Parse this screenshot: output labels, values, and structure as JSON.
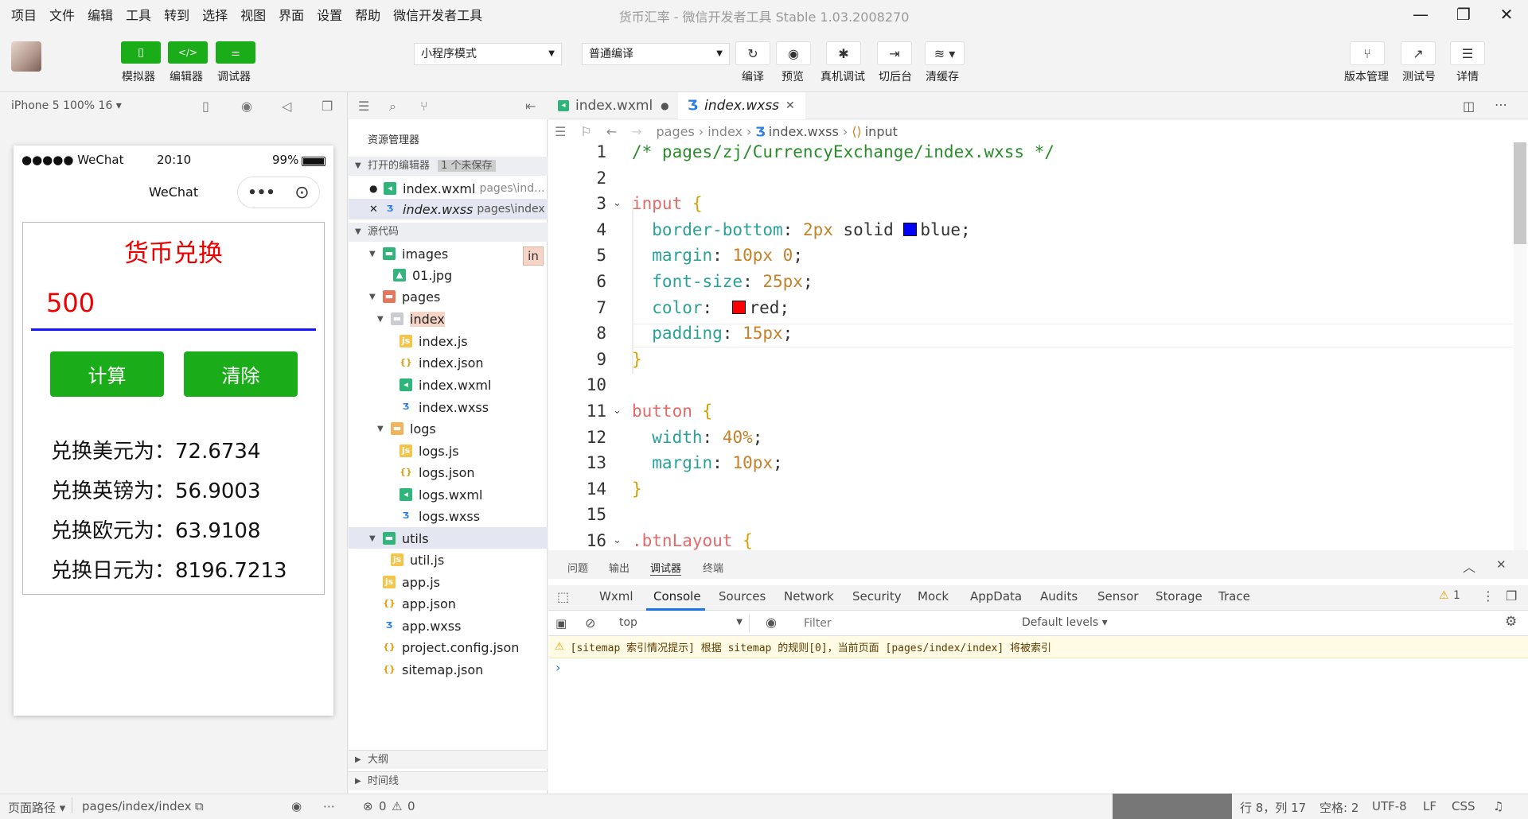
{
  "menu": [
    "项目",
    "文件",
    "编辑",
    "工具",
    "转到",
    "选择",
    "视图",
    "界面",
    "设置",
    "帮助",
    "微信开发者工具"
  ],
  "window_title": "货币汇率 - 微信开发者工具 Stable 1.03.2008270",
  "toolbar": {
    "simulator": "模拟器",
    "editor": "编辑器",
    "debugger": "调试器",
    "mode": "小程序模式",
    "compile_mode": "普通编译",
    "compile": "编译",
    "preview": "预览",
    "real_debug": "真机调试",
    "background": "切后台",
    "clear_cache": "清缓存",
    "version": "版本管理",
    "test": "测试号",
    "details": "详情"
  },
  "sim": {
    "device": "iPhone 5 100% 16 ▾",
    "carrier": "●●●●● WeChat",
    "time": "20:10",
    "battery": "99%",
    "nav_title": "WeChat",
    "app_title": "货币兑换",
    "amount": "500",
    "calc_btn": "计算",
    "clear_btn": "清除",
    "results": [
      "兑换美元为：72.6734",
      "兑换英镑为：56.9003",
      "兑换欧元为：63.9108",
      "兑换日元为：8196.7213"
    ]
  },
  "explorer": {
    "title": "资源管理器",
    "open_editors": "打开的编辑器",
    "unsaved": "1 个未保存",
    "open_files": [
      {
        "name": "index.wxml",
        "path": "pages\\ind..."
      },
      {
        "name": "index.wxss",
        "path": "pages\\index"
      }
    ],
    "source": "源代码",
    "tree": [
      "images",
      "01.jpg",
      "pages",
      "index",
      "index.js",
      "index.json",
      "index.wxml",
      "index.wxss",
      "logs",
      "logs.js",
      "logs.json",
      "logs.wxml",
      "logs.wxss",
      "utils",
      "util.js",
      "app.js",
      "app.json",
      "app.wxss",
      "project.config.json",
      "sitemap.json"
    ],
    "badge": "in",
    "outline": "大纲",
    "timeline": "时间线"
  },
  "editor": {
    "tabs": [
      "index.wxml",
      "index.wxss"
    ],
    "breadcrumb": [
      "pages",
      "index",
      "index.wxss",
      "input"
    ],
    "line_numbers": [
      "1",
      "2",
      "3",
      "4",
      "5",
      "6",
      "7",
      "8",
      "9",
      "10",
      "11",
      "12",
      "13",
      "14",
      "15",
      "16"
    ],
    "lines": [
      [
        {
          "t": "/* pages/zj/CurrencyExchange/index.wxss */",
          "c": "cm"
        }
      ],
      [],
      [
        {
          "t": "input ",
          "c": "sl"
        },
        {
          "t": "{",
          "c": "br"
        }
      ],
      [
        {
          "t": "  border-bottom",
          "c": "pr"
        },
        {
          "t": ": "
        },
        {
          "t": "2px",
          "c": "nu"
        },
        {
          "t": " solid "
        },
        {
          "sw": "#0000ff"
        },
        {
          "t": "blue;"
        }
      ],
      [
        {
          "t": "  margin",
          "c": "pr"
        },
        {
          "t": ": "
        },
        {
          "t": "10px 0",
          "c": "nu"
        },
        {
          "t": ";"
        }
      ],
      [
        {
          "t": "  font-size",
          "c": "pr"
        },
        {
          "t": ": "
        },
        {
          "t": "25px",
          "c": "nu"
        },
        {
          "t": ";"
        }
      ],
      [
        {
          "t": "  color",
          "c": "pr"
        },
        {
          "t": ":  "
        },
        {
          "sw": "#ff0000"
        },
        {
          "t": "red;"
        }
      ],
      [
        {
          "t": "  padding",
          "c": "pr"
        },
        {
          "t": ": "
        },
        {
          "t": "15px",
          "c": "nu"
        },
        {
          "t": ";"
        }
      ],
      [
        {
          "t": "}",
          "c": "br"
        }
      ],
      [],
      [
        {
          "t": "button ",
          "c": "sl"
        },
        {
          "t": "{",
          "c": "br"
        }
      ],
      [
        {
          "t": "  width",
          "c": "pr"
        },
        {
          "t": ": "
        },
        {
          "t": "40%",
          "c": "nu"
        },
        {
          "t": ";"
        }
      ],
      [
        {
          "t": "  margin",
          "c": "pr"
        },
        {
          "t": ": "
        },
        {
          "t": "10px",
          "c": "nu"
        },
        {
          "t": ";"
        }
      ],
      [
        {
          "t": "}",
          "c": "br"
        }
      ],
      [],
      [
        {
          "t": ".btnLayout ",
          "c": "sl"
        },
        {
          "t": "{",
          "c": "br"
        }
      ]
    ]
  },
  "devtools": {
    "top_tabs": [
      "问题",
      "输出",
      "调试器",
      "终端"
    ],
    "tabs": [
      "Wxml",
      "Console",
      "Sources",
      "Network",
      "Security",
      "Mock",
      "AppData",
      "Audits",
      "Sensor",
      "Storage",
      "Trace"
    ],
    "warn_count": "1",
    "context": "top",
    "filter_placeholder": "Filter",
    "levels": "Default levels ▾",
    "warning": "[sitemap 索引情况提示] 根据 sitemap 的规则[0]，当前页面 [pages/index/index] 将被索引"
  },
  "statusbar": {
    "path_label": "页面路径 ▾",
    "path": "pages/index/index",
    "errors": "0",
    "warnings": "0",
    "cursor": "行 8，列 17",
    "spaces": "空格: 2",
    "encoding": "UTF-8",
    "eol": "LF",
    "lang": "CSS"
  }
}
